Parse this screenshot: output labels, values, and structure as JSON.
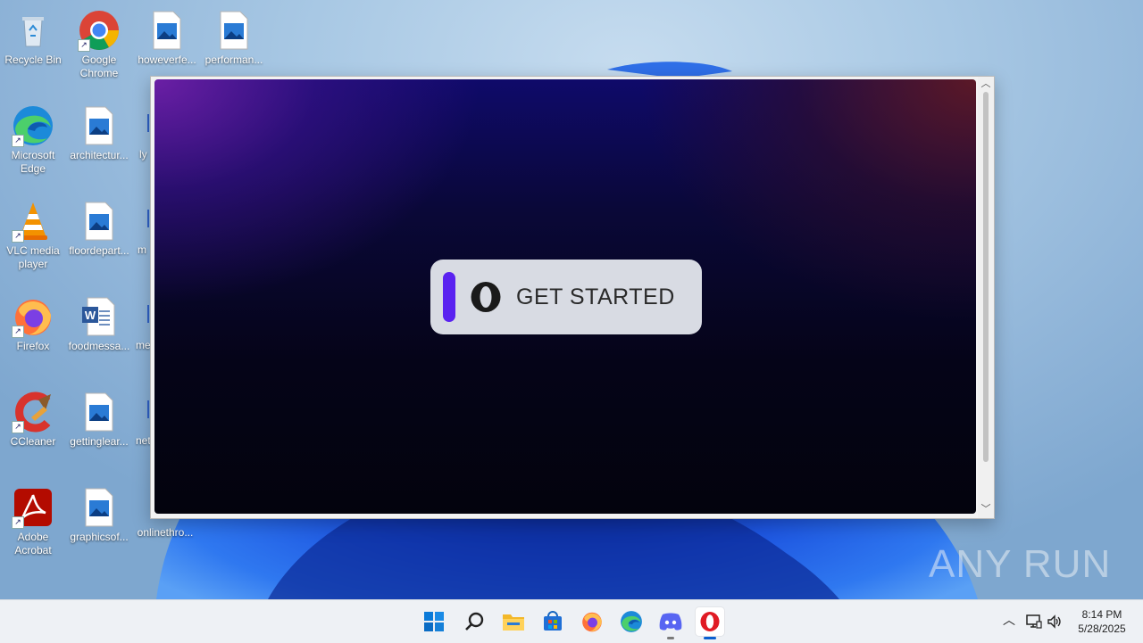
{
  "desktop": {
    "icons": [
      {
        "label": "Recycle Bin"
      },
      {
        "label": "Google\nChrome"
      },
      {
        "label": "howeverfe..."
      },
      {
        "label": "performan..."
      },
      {
        "label": "Microsoft\nEdge"
      },
      {
        "label": "architectur..."
      },
      {
        "label": "VLC media\nplayer"
      },
      {
        "label": "floordepart..."
      },
      {
        "label": "Firefox"
      },
      {
        "label": "foodmessa..."
      },
      {
        "label": "CCleaner"
      },
      {
        "label": "gettinglear..."
      },
      {
        "label": "Adobe\nAcrobat"
      },
      {
        "label": "graphicsof..."
      },
      {
        "label": "onlinethro..."
      }
    ],
    "partial_labels": [
      "ly",
      "m",
      "me",
      "net"
    ]
  },
  "installer": {
    "button_label": "GET STARTED",
    "accent_color": "#5a22f0"
  },
  "watermark": {
    "text": "ANY RUN"
  },
  "taskbar": {
    "icons": [
      "windows-start-icon",
      "search-icon",
      "file-explorer-icon",
      "microsoft-store-icon",
      "firefox-icon",
      "edge-icon",
      "discord-icon",
      "opera-icon"
    ]
  },
  "tray": {
    "time": "8:14 PM",
    "date": "5/28/2025"
  }
}
